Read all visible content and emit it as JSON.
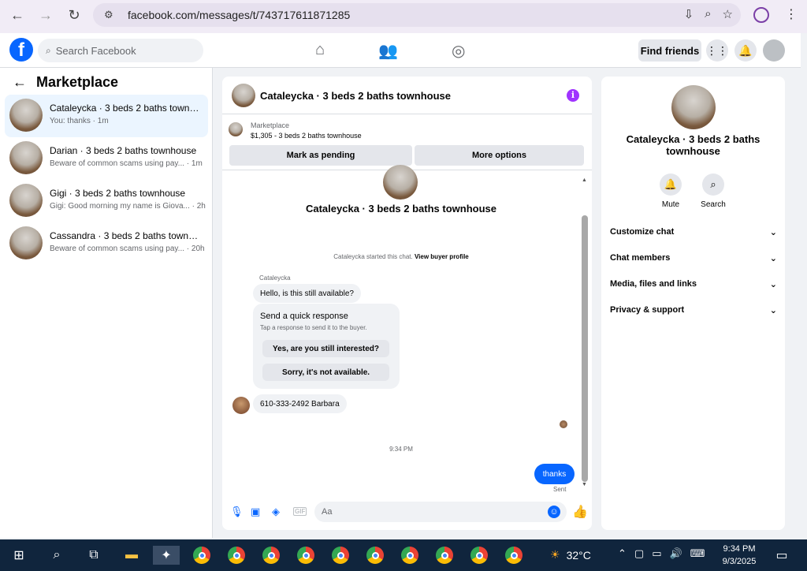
{
  "browser": {
    "url": "facebook.com/messages/t/743717611871285",
    "icons": [
      "back-arrow-icon",
      "forward-arrow-icon",
      "reload-icon",
      "site-settings-icon",
      "install-icon",
      "zoom-icon",
      "star-icon",
      "profile-icon",
      "menu-kebab-icon"
    ]
  },
  "topbar": {
    "search_placeholder": "Search Facebook",
    "find_friends": "Find friends"
  },
  "sidebar": {
    "title": "Marketplace",
    "conversations": [
      {
        "name": "Cataleycka · 3 beds 2 baths townh...",
        "sub": "You: thanks · 1m"
      },
      {
        "name": "Darian · 3 beds 2 baths townhouse",
        "sub": "Beware of common scams using pay... · 1m"
      },
      {
        "name": "Gigi · 3 beds 2 baths townhouse",
        "sub": "Gigi: Good morning my name is Giova... · 2h"
      },
      {
        "name": "Cassandra · 3 beds 2 baths townh...",
        "sub": "Beware of common scams using pay... · 20h"
      }
    ]
  },
  "chat": {
    "title": "Cataleycka · 3 beds 2 baths townhouse",
    "marketplace_label": "Marketplace",
    "listing": "$1,305 - 3 beds 2 baths townhouse",
    "mark_pending": "Mark as pending",
    "more_options": "More options",
    "big_name": "Cataleycka · 3 beds 2 baths townhouse",
    "started_text": "Cataleycka started this chat.",
    "view_profile": "View buyer profile",
    "sender": "Cataleycka",
    "msg_available": "Hello, is this still available?",
    "quick_title": "Send a quick response",
    "quick_sub": "Tap a response to send it to the buyer.",
    "quick_opt_1": "Yes, are you still interested?",
    "quick_opt_2": "Sorry, it's not available.",
    "msg_phone": "610-333-2492 Barbara",
    "time": "9:34 PM",
    "msg_mine": "thanks",
    "sent": "Sent",
    "composer_placeholder": "Aa"
  },
  "rpanel": {
    "name": "Cataleycka · 3 beds 2 baths townhouse",
    "mute": "Mute",
    "search": "Search",
    "rows": [
      "Customize chat",
      "Chat members",
      "Media, files and links",
      "Privacy & support"
    ]
  },
  "taskbar": {
    "temp": "32°C",
    "time": "9:34 PM",
    "date": "9/3/2025"
  },
  "colors": {
    "brand": "#0866ff",
    "info": "#a033ff",
    "taskbar": "#10253d"
  }
}
